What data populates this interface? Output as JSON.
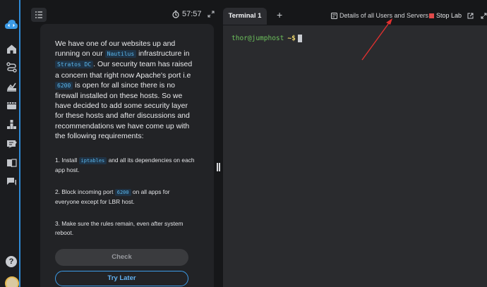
{
  "timer": "57:57",
  "question": {
    "intro_parts": [
      "We have one of our websites up and running on our ",
      "Nautilus",
      " infrastructure in ",
      "Stratos DC",
      ". Our security team has raised a concern that right now Apache's port i.e ",
      "6200",
      " is open for all since there is no firewall installed on these hosts. So we have decided to add some security layer for these hosts and after discussions and recommendations we have come up with the following requirements:"
    ],
    "req1": [
      "1. Install ",
      "iptables",
      " and all its dependencies on each app host."
    ],
    "req2": [
      "2. Block incoming port ",
      "6200",
      " on all apps for everyone except for LBR host."
    ],
    "req3": "3. Make sure the rules remain, even after system reboot."
  },
  "buttons": {
    "check": "Check",
    "try_later": "Try Later"
  },
  "terminal": {
    "tab_label": "Terminal 1",
    "add_tab": "+",
    "details_link": "Details of all Users and Servers",
    "stop_lab": "Stop Lab",
    "prompt_user": "thor@jumphost",
    "prompt_suffix": "~$"
  },
  "icons": {
    "rail": [
      "cloud-logo-icon",
      "home-icon",
      "route-icon",
      "chart-icon",
      "film-icon",
      "hierarchy-icon",
      "edit-icon",
      "book-icon",
      "chat-icon",
      "help-icon",
      "avatar"
    ],
    "header": [
      "menu-icon",
      "stopwatch-icon",
      "expand-icon",
      "server-icon",
      "stop-icon",
      "external-link-icon",
      "expand-icon"
    ]
  },
  "colors": {
    "accent": "#2f8bd6",
    "code_text": "#5ab8ee",
    "prompt_green": "#6dc25c",
    "stop_red": "#e04a4a",
    "annotation_arrow": "#e0302f"
  }
}
